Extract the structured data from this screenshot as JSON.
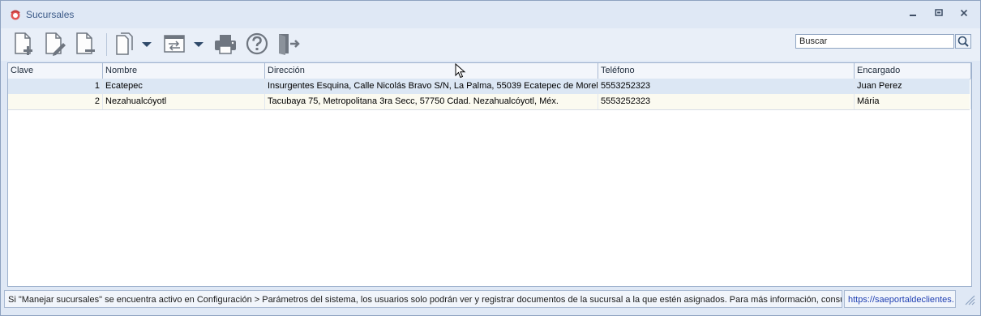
{
  "window": {
    "title": "Sucursales"
  },
  "icons": {
    "app": "branch-app-icon",
    "new": "new-document-icon",
    "edit": "edit-document-icon",
    "delete": "delete-document-icon",
    "copy": "copy-document-icon",
    "transfer": "transfer-window-icon",
    "print": "printer-icon",
    "help": "help-icon",
    "exit": "exit-door-icon",
    "search": "search-icon"
  },
  "search": {
    "placeholder": "Buscar",
    "value": ""
  },
  "table": {
    "columns": [
      "Clave",
      "Nombre",
      "Dirección",
      "Teléfono",
      "Encargado"
    ],
    "rows": [
      {
        "clave": "1",
        "nombre": "Ecatepec",
        "direccion": "Insurgentes Esquina, Calle Nicolás Bravo S/N, La Palma, 55039 Ecatepec de Morelos",
        "telefono": "5553252323",
        "encargado": "Juan Perez"
      },
      {
        "clave": "2",
        "nombre": "Nezahualcóyotl",
        "direccion": "Tacubaya 75, Metropolitana 3ra Secc, 57750 Cdad. Nezahualcóyotl, Méx.",
        "telefono": "5553252323",
        "encargado": "Mária"
      }
    ]
  },
  "status": {
    "message": "Si \"Manejar sucursales\" se encuentra activo en Configuración > Parámetros del sistema, los usuarios solo podrán ver y registrar documentos de la sucursal a la que estén asignados. Para más información, consulta:",
    "link": "https://saeportaldeclientes."
  },
  "colors": {
    "title_text": "#3b5a88",
    "selected_row": "#dce7f4",
    "alt_row": "#fbfaf0",
    "link": "#1f3fb2",
    "icon_gray": "#6f7680"
  }
}
